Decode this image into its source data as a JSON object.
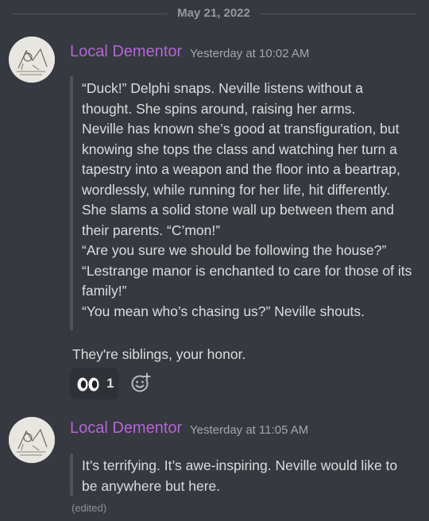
{
  "divider": {
    "date": "May 21, 2022"
  },
  "messages": [
    {
      "author": "Local Dementor",
      "timestamp": "Yesterday at 10:02 AM",
      "quote_lines": [
        "“Duck!” Delphi snaps. Neville listens without a",
        "thought. She spins around, raising her arms.",
        "Neville has known she’s good at transfiguration, but",
        "knowing she tops the class and watching her turn a",
        "tapestry into a weapon and the floor into a beartrap,",
        "wordlessly, while running for her life, hit differently.",
        "She slams a solid stone wall up between them and",
        "their parents. “C’mon!”",
        "“Are you sure we should be following the house?”",
        "“Lestrange manor is enchanted to care for those of its",
        "family!”",
        "“You mean who’s chasing us?” Neville shouts."
      ],
      "text": "They're siblings, your honor.",
      "reactions": [
        {
          "icon": "eyes-emoji-icon",
          "count": "1"
        }
      ]
    },
    {
      "author": "Local Dementor",
      "timestamp": "Yesterday at 11:05 AM",
      "quote_lines": [
        "It’s terrifying. It’s awe-inspiring. Neville would like to",
        "be anywhere but here."
      ],
      "edited": "(edited)"
    }
  ],
  "colors": {
    "background": "#36393f",
    "username": "#b365d9",
    "text": "#dcddde",
    "muted": "#a3a6aa",
    "quote_bar": "#4f545c",
    "reaction_bg": "#2f3136"
  }
}
